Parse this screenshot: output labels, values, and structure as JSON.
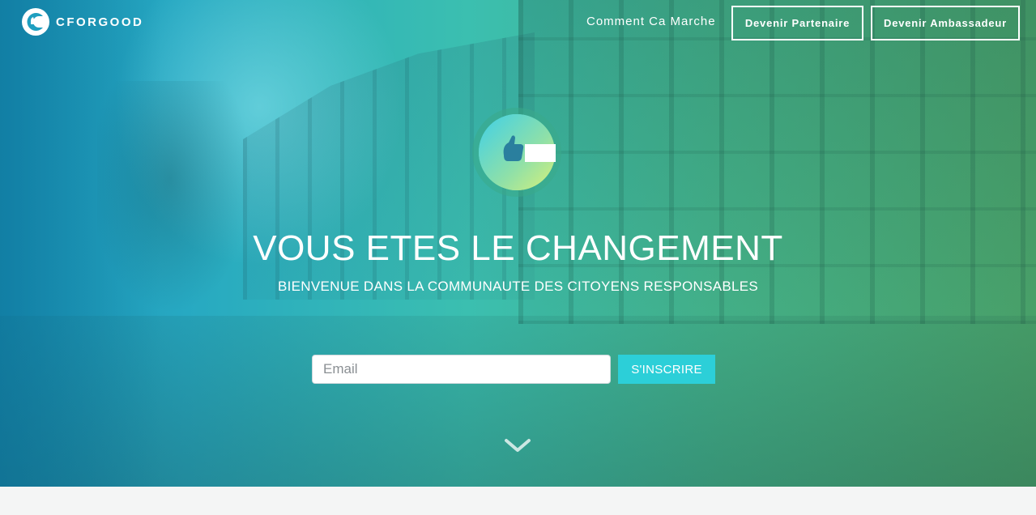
{
  "header": {
    "brand": "CFORGOOD",
    "nav_link": "Comment Ca Marche",
    "partner_button": "Devenir Partenaire",
    "ambassador_button": "Devenir Ambassadeur"
  },
  "hero": {
    "headline": "VOUS ETES LE CHANGEMENT",
    "subline": "BIENVENUE DANS LA COMMUNAUTE DES CITOYENS RESPONSABLES",
    "email_placeholder": "Email",
    "email_value": "",
    "subscribe_button": "S'INSCRIRE",
    "scroll_icon": "chevron-down-icon",
    "logo_icon": "thumbs-up-c-logo-icon"
  },
  "colors": {
    "accent": "#2ccfd8",
    "gradient_left": "#1b93b6",
    "gradient_right": "#4ba46a",
    "text": "#ffffff"
  }
}
